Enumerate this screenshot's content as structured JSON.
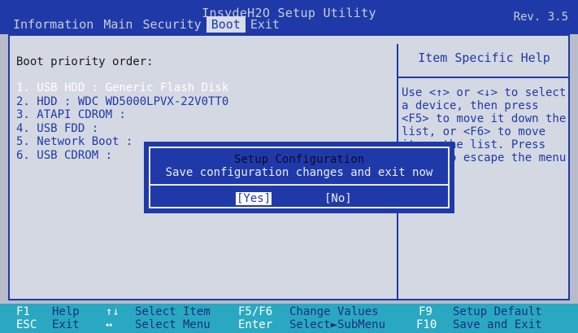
{
  "title_bar": {
    "title": "InsydeH2O Setup Utility",
    "version": "Rev. 3.5",
    "menu": [
      "Information",
      "Main",
      "Security",
      "Boot",
      "Exit"
    ],
    "active_menu": "Boot"
  },
  "boot": {
    "heading": "Boot priority order:",
    "items": [
      "1. USB HDD : Generic Flash Disk",
      "2. HDD : WDC WD5000LPVX-22V0TT0",
      "3. ATAPI CDROM :",
      "4. USB FDD :",
      "5. Network Boot :",
      "6. USB CDROM :"
    ],
    "selected_index": 0
  },
  "help": {
    "title": "Item Specific Help",
    "text": "Use <↑> or <↓> to select\na device, then press\n<F5> to move it down the\nlist, or <F6> to move\nit up the list. Press\n<Esc> to escape the menu"
  },
  "dialog": {
    "title": "Setup Configuration",
    "message": "Save configuration changes and exit now",
    "yes_label": "[Yes]",
    "no_label": "[No]"
  },
  "footer": {
    "row1": [
      {
        "key": "F1",
        "desc": "Help"
      },
      {
        "key": "↑↓",
        "desc": "Select Item"
      },
      {
        "key": "F5/F6",
        "desc": "Change Values"
      },
      {
        "key": "F9",
        "desc": "Setup Default"
      }
    ],
    "row2": [
      {
        "key": "ESC",
        "desc": "Exit"
      },
      {
        "key": "↔",
        "desc": "Select Menu"
      },
      {
        "key": "Enter",
        "desc": "Select►SubMenu"
      },
      {
        "key": "F10",
        "desc": "Save and Exit"
      }
    ]
  },
  "colors": {
    "bios_blue": "#1f3aa8",
    "panel_gray": "#d4d8e2",
    "footer_cyan": "#2aa8c2"
  }
}
